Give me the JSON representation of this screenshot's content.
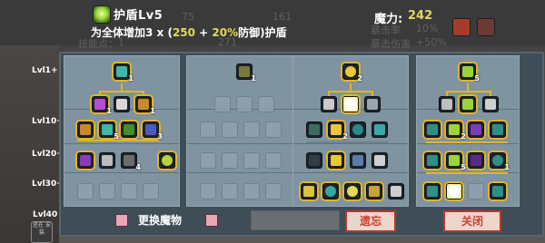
{
  "header": {
    "skill_name": "护盾Lv5",
    "mana_label": "魔力:",
    "mana_value": "242",
    "desc_prefix": "为全体增加3 x (",
    "desc_a": "250",
    "desc_plus": " + ",
    "desc_b": "20%",
    "desc_suffix": "防御)护盾"
  },
  "background_text": {
    "skill_points": "技能点：",
    "crit_rate": "暴击率",
    "crit_rate_val": "10%",
    "crit_dmg": "暴击伤害",
    "crit_dmg_val": "+50%",
    "num1": "271",
    "num2": "161",
    "num3": "75",
    "num4": "1"
  },
  "rows": {
    "lvl1": "Lvl1+",
    "lvl10": "Lvl10+",
    "lvl20": "Lvl20+",
    "lvl30": "Lvl30+",
    "lvl40": "Lvl40"
  },
  "levels": {
    "p1_top": "1",
    "p1_a": "1",
    "p1_b": "1",
    "p1_r2a": "5",
    "p1_r2b": "3",
    "p1_r3": "4",
    "p2_top": "1",
    "p3_top": "2",
    "p3_r2": "2",
    "p4_top": "5",
    "p4_r2": "2",
    "p4_r3": "5",
    "p4_r4": "1"
  },
  "buttons": {
    "swap_monster": "更换魔物",
    "forget": "遗忘",
    "close": "关闭"
  },
  "avatar_text": "还在\n安装",
  "colors": {
    "accent": "#e3d85a",
    "connector": "#e2b42a",
    "panel": "#7f93a0",
    "board": "#3f4d56",
    "close_border": "#b6372f"
  }
}
